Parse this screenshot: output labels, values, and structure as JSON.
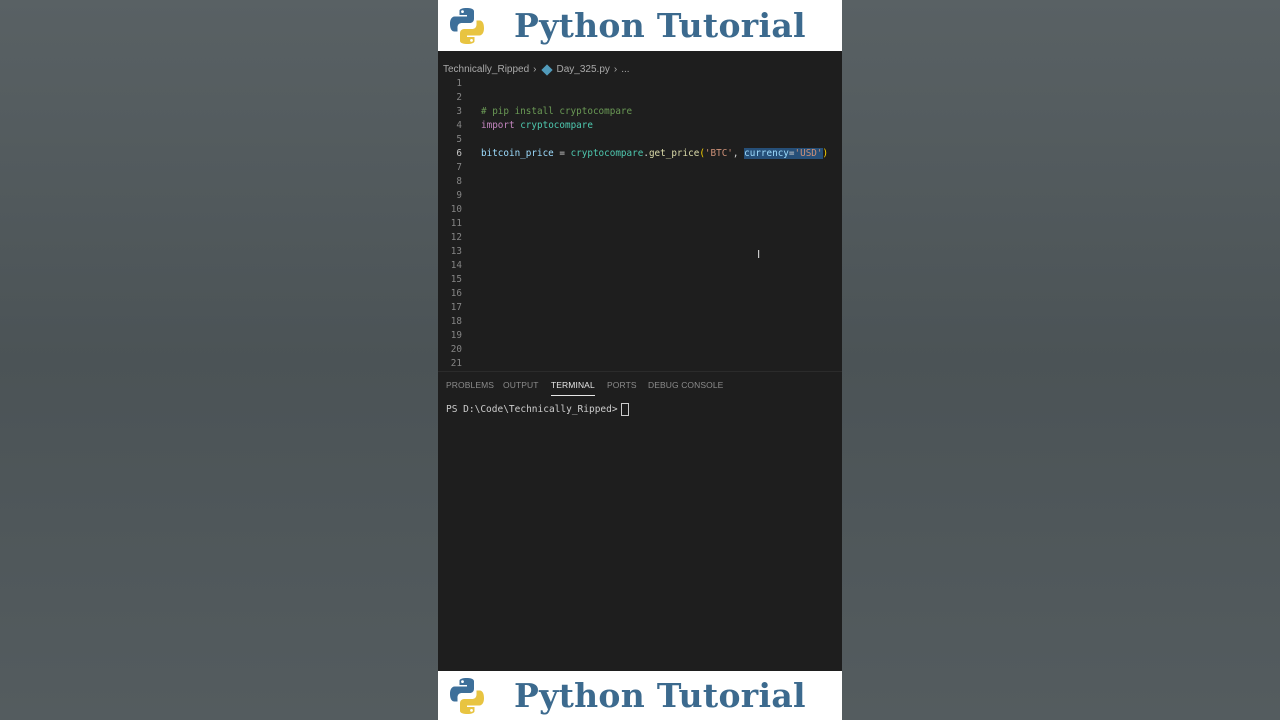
{
  "banner": {
    "title": "Python Tutorial"
  },
  "breadcrumb": {
    "folder": "Technically_Ripped",
    "file": "Day_325.py",
    "more": "..."
  },
  "editor": {
    "line_numbers": [
      "1",
      "2",
      "3",
      "4",
      "5",
      "6",
      "7",
      "8",
      "9",
      "10",
      "11",
      "12",
      "13",
      "14",
      "15",
      "16",
      "17",
      "18",
      "19",
      "20",
      "21"
    ],
    "active_line": "6",
    "code": {
      "l3_comment": "# pip install cryptocompare",
      "l4_import": "import",
      "l4_module": "cryptocompare",
      "l6_var": "bitcoin_price",
      "l6_eq": " = ",
      "l6_module": "cryptocompare",
      "l6_dot": ".",
      "l6_fn": "get_price",
      "l6_open": "(",
      "l6_arg1": "'BTC'",
      "l6_comma": ", ",
      "l6_kw": "currency",
      "l6_kweq": "=",
      "l6_arg2": "'USD'",
      "l6_close": ")"
    }
  },
  "panel": {
    "tabs": [
      "PROBLEMS",
      "OUTPUT",
      "TERMINAL",
      "PORTS",
      "DEBUG CONSOLE"
    ],
    "active_tab": "TERMINAL"
  },
  "terminal": {
    "prompt": "PS D:\\Code\\Technically_Ripped>"
  },
  "colors": {
    "accent_title": "#3c6a8e",
    "editor_bg": "#1e1e1e",
    "selection": "#264f78"
  },
  "icons": {
    "logo": "python-logo-icon",
    "file": "python-file-icon",
    "cursor": "text-cursor-icon"
  }
}
